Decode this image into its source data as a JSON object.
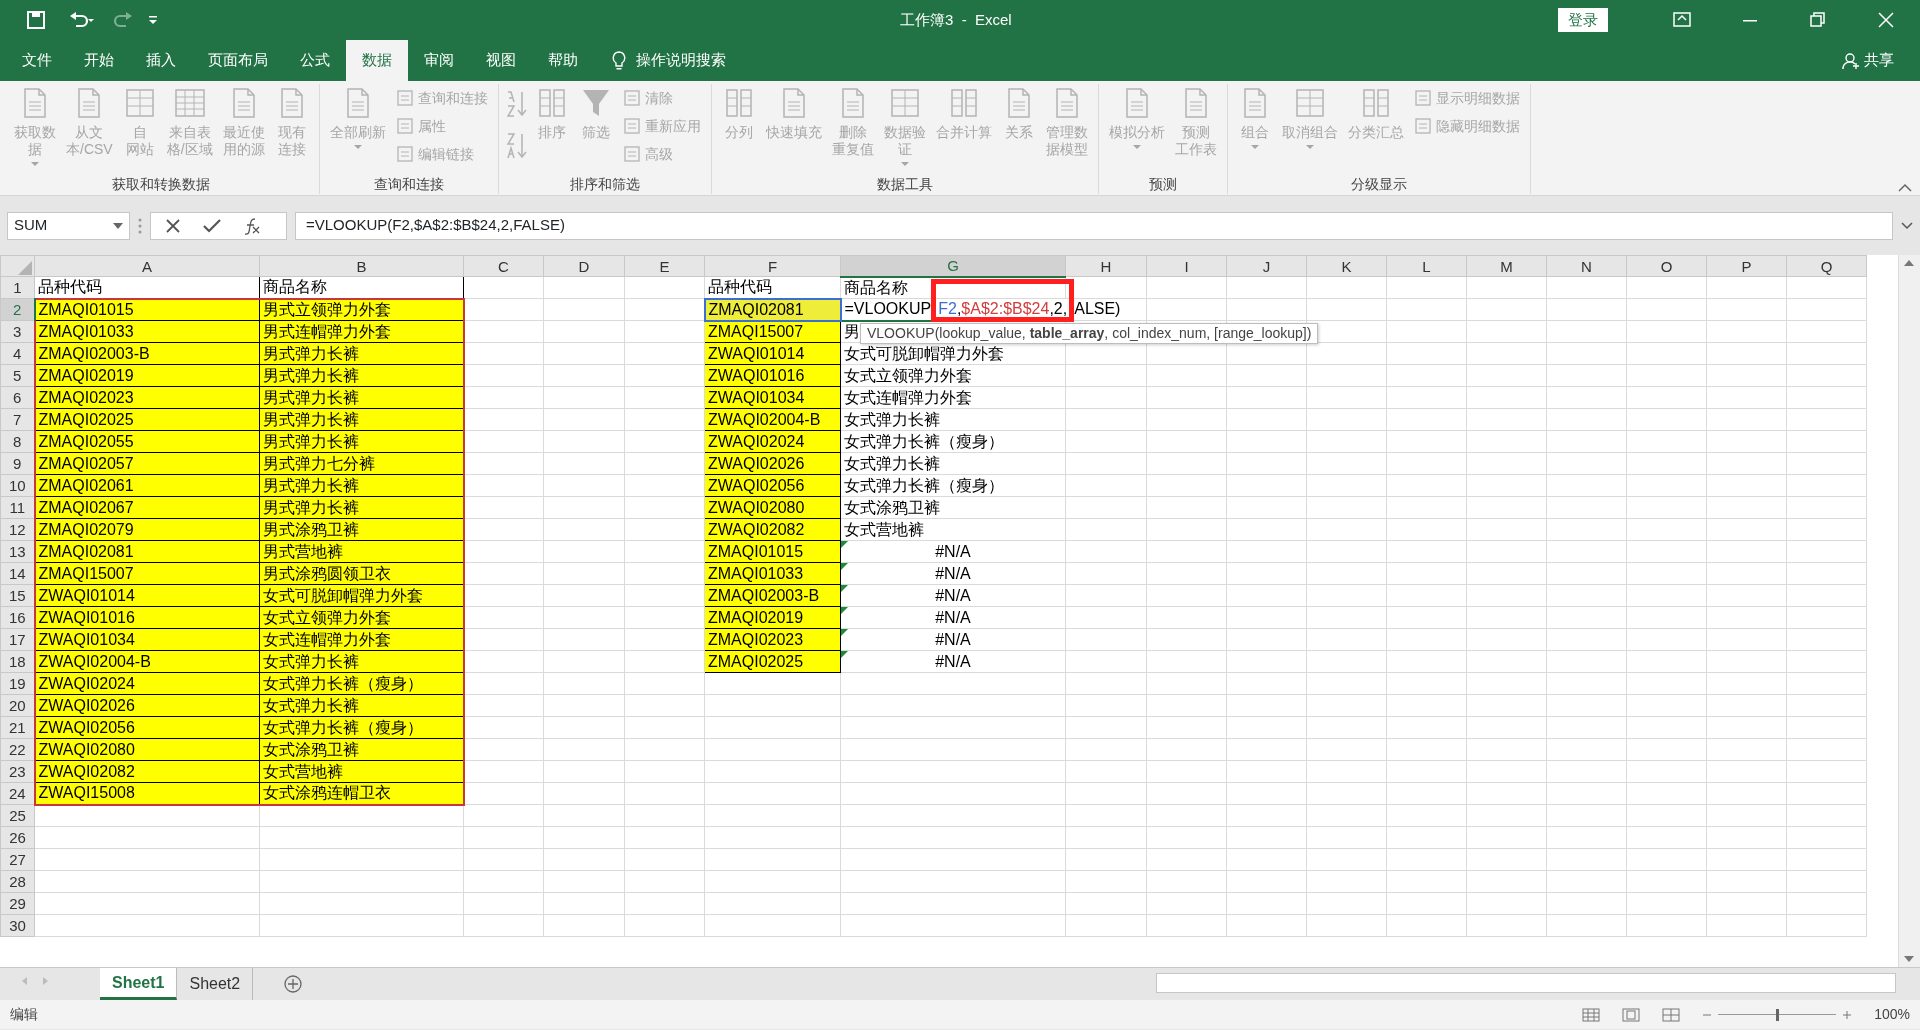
{
  "title_bar": {
    "title": "工作簿3  -  Excel",
    "login": "登录"
  },
  "menu_tabs": [
    {
      "label": "文件",
      "selected": false
    },
    {
      "label": "开始",
      "selected": false
    },
    {
      "label": "插入",
      "selected": false
    },
    {
      "label": "页面布局",
      "selected": false
    },
    {
      "label": "公式",
      "selected": false
    },
    {
      "label": "数据",
      "selected": true
    },
    {
      "label": "审阅",
      "selected": false
    },
    {
      "label": "视图",
      "selected": false
    },
    {
      "label": "帮助",
      "selected": false
    }
  ],
  "tell_me": "操作说明搜索",
  "share": "共享",
  "ribbon": {
    "disabled": true,
    "groups": [
      {
        "title": "获取和转换数据",
        "items": [
          {
            "kind": "large",
            "lines": [
              "获取数",
              "据"
            ],
            "dropdown": true
          },
          {
            "kind": "large",
            "lines": [
              "从文",
              "本/CSV"
            ],
            "dropdown": false
          },
          {
            "kind": "large",
            "lines": [
              "自",
              "网站"
            ],
            "dropdown": false
          },
          {
            "kind": "large",
            "lines": [
              "来自表",
              "格/区域"
            ],
            "dropdown": false
          },
          {
            "kind": "large",
            "lines": [
              "最近使",
              "用的源"
            ],
            "dropdown": false
          },
          {
            "kind": "large",
            "lines": [
              "现有",
              "连接"
            ],
            "dropdown": false
          }
        ]
      },
      {
        "title": "查询和连接",
        "items": [
          {
            "kind": "large",
            "lines": [
              "全部刷新"
            ],
            "dropdown": true
          },
          {
            "kind": "small",
            "lines": [
              "查询和连接"
            ],
            "dropdown": false
          },
          {
            "kind": "small",
            "lines": [
              "属性"
            ],
            "dropdown": false
          },
          {
            "kind": "small",
            "lines": [
              "编辑链接"
            ],
            "dropdown": false
          }
        ]
      },
      {
        "title": "排序和筛选",
        "items": [
          {
            "kind": "sortpair"
          },
          {
            "kind": "large",
            "lines": [
              "排序"
            ],
            "dropdown": false
          },
          {
            "kind": "large",
            "lines": [
              "筛选"
            ],
            "dropdown": false
          },
          {
            "kind": "small",
            "lines": [
              "清除"
            ],
            "dropdown": false
          },
          {
            "kind": "small",
            "lines": [
              "重新应用"
            ],
            "dropdown": false
          },
          {
            "kind": "small",
            "lines": [
              "高级"
            ],
            "dropdown": false
          }
        ]
      },
      {
        "title": "数据工具",
        "items": [
          {
            "kind": "large",
            "lines": [
              "分列"
            ],
            "dropdown": false
          },
          {
            "kind": "large",
            "lines": [
              "快速填充"
            ],
            "dropdown": false
          },
          {
            "kind": "large",
            "lines": [
              "删除",
              "重复值"
            ],
            "dropdown": false
          },
          {
            "kind": "large",
            "lines": [
              "数据验",
              "证"
            ],
            "dropdown": true
          },
          {
            "kind": "large",
            "lines": [
              "合并计算"
            ],
            "dropdown": false
          },
          {
            "kind": "large",
            "lines": [
              "关系"
            ],
            "dropdown": false
          },
          {
            "kind": "large",
            "lines": [
              "管理数",
              "据模型"
            ],
            "dropdown": false
          }
        ]
      },
      {
        "title": "预测",
        "items": [
          {
            "kind": "large",
            "lines": [
              "模拟分析"
            ],
            "dropdown": true
          },
          {
            "kind": "large",
            "lines": [
              "预测",
              "工作表"
            ],
            "dropdown": false
          }
        ]
      },
      {
        "title": "分级显示",
        "items": [
          {
            "kind": "large",
            "lines": [
              "组合"
            ],
            "dropdown": true
          },
          {
            "kind": "large",
            "lines": [
              "取消组合"
            ],
            "dropdown": true
          },
          {
            "kind": "large",
            "lines": [
              "分类汇总"
            ],
            "dropdown": false
          },
          {
            "kind": "small",
            "lines": [
              "显示明细数据"
            ],
            "dropdown": false
          },
          {
            "kind": "small",
            "lines": [
              "隐藏明细数据"
            ],
            "dropdown": false
          }
        ]
      }
    ]
  },
  "formula_bar": {
    "name_box": "SUM",
    "formula": "=VLOOKUP(F2,$A$2:$B$24,2,FALSE)"
  },
  "column_headers": [
    {
      "label": "A",
      "selected": false
    },
    {
      "label": "B",
      "selected": false
    },
    {
      "label": "C",
      "selected": false
    },
    {
      "label": "D",
      "selected": false
    },
    {
      "label": "E",
      "selected": false
    },
    {
      "label": "F",
      "selected": false
    },
    {
      "label": "G",
      "selected": true
    },
    {
      "label": "H",
      "selected": false
    },
    {
      "label": "I",
      "selected": false
    },
    {
      "label": "J",
      "selected": false
    },
    {
      "label": "K",
      "selected": false
    },
    {
      "label": "L",
      "selected": false
    },
    {
      "label": "M",
      "selected": false
    },
    {
      "label": "N",
      "selected": false
    },
    {
      "label": "O",
      "selected": false
    },
    {
      "label": "P",
      "selected": false
    },
    {
      "label": "Q",
      "selected": false
    }
  ],
  "row_headers": [
    {
      "label": "1",
      "selected": false
    },
    {
      "label": "2",
      "selected": true
    },
    {
      "label": "3",
      "selected": false
    },
    {
      "label": "4",
      "selected": false
    },
    {
      "label": "5",
      "selected": false
    },
    {
      "label": "6",
      "selected": false
    },
    {
      "label": "7",
      "selected": false
    },
    {
      "label": "8",
      "selected": false
    },
    {
      "label": "9",
      "selected": false
    },
    {
      "label": "10",
      "selected": false
    },
    {
      "label": "11",
      "selected": false
    },
    {
      "label": "12",
      "selected": false
    },
    {
      "label": "13",
      "selected": false
    },
    {
      "label": "14",
      "selected": false
    },
    {
      "label": "15",
      "selected": false
    },
    {
      "label": "16",
      "selected": false
    },
    {
      "label": "17",
      "selected": false
    },
    {
      "label": "18",
      "selected": false
    },
    {
      "label": "19",
      "selected": false
    },
    {
      "label": "20",
      "selected": false
    },
    {
      "label": "21",
      "selected": false
    },
    {
      "label": "22",
      "selected": false
    },
    {
      "label": "23",
      "selected": false
    },
    {
      "label": "24",
      "selected": false
    },
    {
      "label": "25",
      "selected": false
    },
    {
      "label": "26",
      "selected": false
    },
    {
      "label": "27",
      "selected": false
    },
    {
      "label": "28",
      "selected": false
    },
    {
      "label": "29",
      "selected": false
    },
    {
      "label": "30",
      "selected": false
    }
  ],
  "source_table": {
    "header": [
      "品种代码",
      "商品名称"
    ],
    "rows": [
      [
        "ZMAQI01015",
        "男式立领弹力外套"
      ],
      [
        "ZMAQI01033",
        "男式连帽弹力外套"
      ],
      [
        "ZMAQI02003-B",
        "男式弹力长裤"
      ],
      [
        "ZMAQI02019",
        "男式弹力长裤"
      ],
      [
        "ZMAQI02023",
        "男式弹力长裤"
      ],
      [
        "ZMAQI02025",
        "男式弹力长裤"
      ],
      [
        "ZMAQI02055",
        "男式弹力长裤"
      ],
      [
        "ZMAQI02057",
        "男式弹力七分裤"
      ],
      [
        "ZMAQI02061",
        "男式弹力长裤"
      ],
      [
        "ZMAQI02067",
        "男式弹力长裤"
      ],
      [
        "ZMAQI02079",
        "男式涂鸦卫裤"
      ],
      [
        "ZMAQI02081",
        "男式营地裤"
      ],
      [
        "ZMAQI15007",
        "男式涂鸦圆领卫衣"
      ],
      [
        "ZWAQI01014",
        "女式可脱卸帽弹力外套"
      ],
      [
        "ZWAQI01016",
        "女式立领弹力外套"
      ],
      [
        "ZWAQI01034",
        "女式连帽弹力外套"
      ],
      [
        "ZWAQI02004-B",
        "女式弹力长裤"
      ],
      [
        "ZWAQI02024",
        "女式弹力长裤（瘦身）"
      ],
      [
        "ZWAQI02026",
        "女式弹力长裤"
      ],
      [
        "ZWAQI02056",
        "女式弹力长裤（瘦身）"
      ],
      [
        "ZWAQI02080",
        "女式涂鸦卫裤"
      ],
      [
        "ZWAQI02082",
        "女式营地裤"
      ],
      [
        "ZWAQI15008",
        "女式涂鸦连帽卫衣"
      ]
    ]
  },
  "lookup_table": {
    "header": [
      "品种代码",
      "商品名称"
    ],
    "rows": [
      {
        "code": "ZMAQI02081",
        "kind": "editing",
        "formula_parts": [
          {
            "text": "=VLOOKUP",
            "kind": "plain",
            "annotated": false
          },
          {
            "text": "F2",
            "kind": "ref",
            "color": "#3b6fd6",
            "annotated": true
          },
          {
            "text": ",",
            "kind": "plain",
            "annotated": true
          },
          {
            "text": "$A$2:$B$24",
            "kind": "ref",
            "color": "#d23c3c",
            "annotated": true
          },
          {
            "text": ",2,",
            "kind": "plain",
            "annotated": true
          },
          {
            "text": "ALSE)",
            "kind": "plain",
            "annotated": false
          }
        ]
      },
      {
        "code": "ZMAQI15007",
        "kind": "text",
        "name": "男"
      },
      {
        "code": "ZWAQI01014",
        "kind": "text",
        "name": "女式可脱卸帽弹力外套"
      },
      {
        "code": "ZWAQI01016",
        "kind": "text",
        "name": "女式立领弹力外套"
      },
      {
        "code": "ZWAQI01034",
        "kind": "text",
        "name": "女式连帽弹力外套"
      },
      {
        "code": "ZWAQI02004-B",
        "kind": "text",
        "name": "女式弹力长裤"
      },
      {
        "code": "ZWAQI02024",
        "kind": "text",
        "name": "女式弹力长裤（瘦身）"
      },
      {
        "code": "ZWAQI02026",
        "kind": "text",
        "name": "女式弹力长裤"
      },
      {
        "code": "ZWAQI02056",
        "kind": "text",
        "name": "女式弹力长裤（瘦身）"
      },
      {
        "code": "ZWAQI02080",
        "kind": "text",
        "name": "女式涂鸦卫裤"
      },
      {
        "code": "ZWAQI02082",
        "kind": "text",
        "name": "女式营地裤"
      },
      {
        "code": "ZMAQI01015",
        "kind": "error",
        "name": "#N/A"
      },
      {
        "code": "ZMAQI01033",
        "kind": "error",
        "name": "#N/A"
      },
      {
        "code": "ZMAQI02003-B",
        "kind": "error",
        "name": "#N/A"
      },
      {
        "code": "ZMAQI02019",
        "kind": "error",
        "name": "#N/A"
      },
      {
        "code": "ZMAQI02023",
        "kind": "error",
        "name": "#N/A"
      },
      {
        "code": "ZMAQI02025",
        "kind": "error",
        "name": "#N/A"
      }
    ]
  },
  "tooltip": "VLOOKUP(lookup_value, **table_array**, col_index_num, [range_lookup])",
  "sheet_tabs": [
    {
      "label": "Sheet1",
      "selected": true
    },
    {
      "label": "Sheet2",
      "selected": false
    }
  ],
  "status_bar": {
    "mode": "编辑",
    "zoom_slider": {
      "level": 0.5
    },
    "zoom": "100%"
  }
}
